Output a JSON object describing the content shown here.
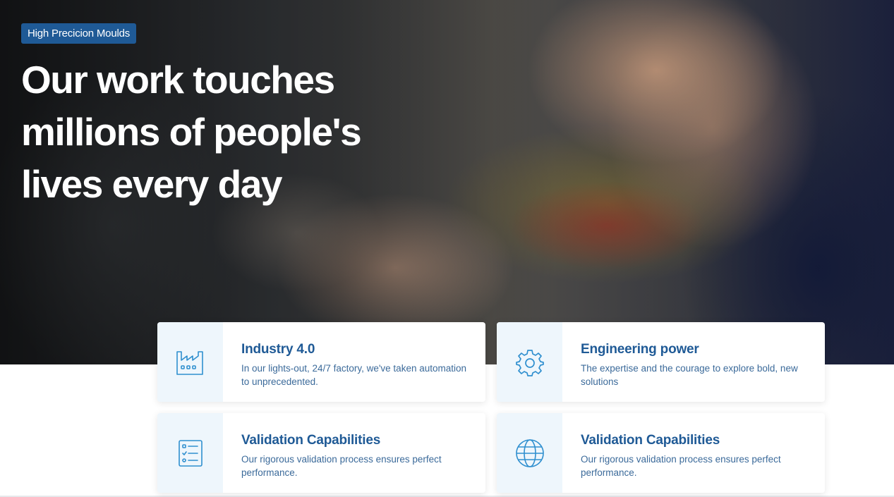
{
  "hero": {
    "badge": "High Precicion Moulds",
    "headline": "Our work touches millions of people's lives every day"
  },
  "cards": [
    {
      "icon": "factory-icon",
      "title": "Industry 4.0",
      "description": "In our lights-out, 24/7 factory, we've taken automation to unprecedented."
    },
    {
      "icon": "gear-icon",
      "title": "Engineering power",
      "description": "The expertise and the courage to explore bold, new solutions"
    },
    {
      "icon": "checklist-icon",
      "title": "Validation Capabilities",
      "description": "Our rigorous validation process ensures perfect performance."
    },
    {
      "icon": "globe-icon",
      "title": "Validation Capabilities",
      "description": "Our rigorous validation process ensures perfect performance."
    }
  ],
  "colors": {
    "accent": "#1f5a96",
    "icon": "#2f8fcf",
    "icon_bg": "#eef6fc"
  }
}
